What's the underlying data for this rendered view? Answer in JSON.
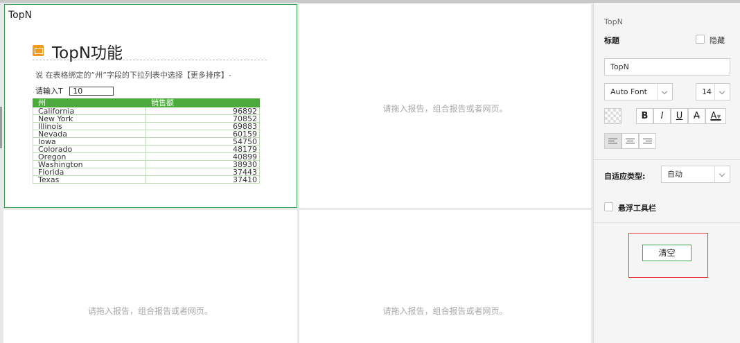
{
  "canvas": {
    "selected_cell": {
      "title": "TopN",
      "report": {
        "name": "TopN功能",
        "description": "说    在表格绑定的“州”字段的下拉列表中选择【更多排序】-",
        "input_label": "请输入T",
        "input_value": "10",
        "table": {
          "columns": [
            "州",
            "销售额"
          ],
          "rows": [
            [
              "California",
              "96892"
            ],
            [
              "New York",
              "70852"
            ],
            [
              "Illinois",
              "69883"
            ],
            [
              "Nevada",
              "60159"
            ],
            [
              "Iowa",
              "54750"
            ],
            [
              "Colorado",
              "48179"
            ],
            [
              "Oregon",
              "40899"
            ],
            [
              "Washington",
              "38930"
            ],
            [
              "Florida",
              "37443"
            ],
            [
              "Texas",
              "37410"
            ]
          ]
        }
      }
    },
    "empty_hint": "请拖入报告，组合报告或者网页。"
  },
  "panel": {
    "title": "TopN",
    "title_label": "标题",
    "hide_label": "隐藏",
    "title_value": "TopN",
    "font_family": "Auto Font",
    "font_size": "14",
    "format_buttons": [
      "B",
      "I",
      "U",
      "A",
      "A"
    ],
    "adapt_label": "自适应类型:",
    "adapt_value": "自动",
    "float_toolbar_label": "悬浮工具栏",
    "clear_label": "清空"
  },
  "colors": {
    "accent_green": "#3aa655",
    "table_header": "#4caa3c",
    "highlight_red": "#e53935",
    "icon_orange": "#f39a1e"
  }
}
